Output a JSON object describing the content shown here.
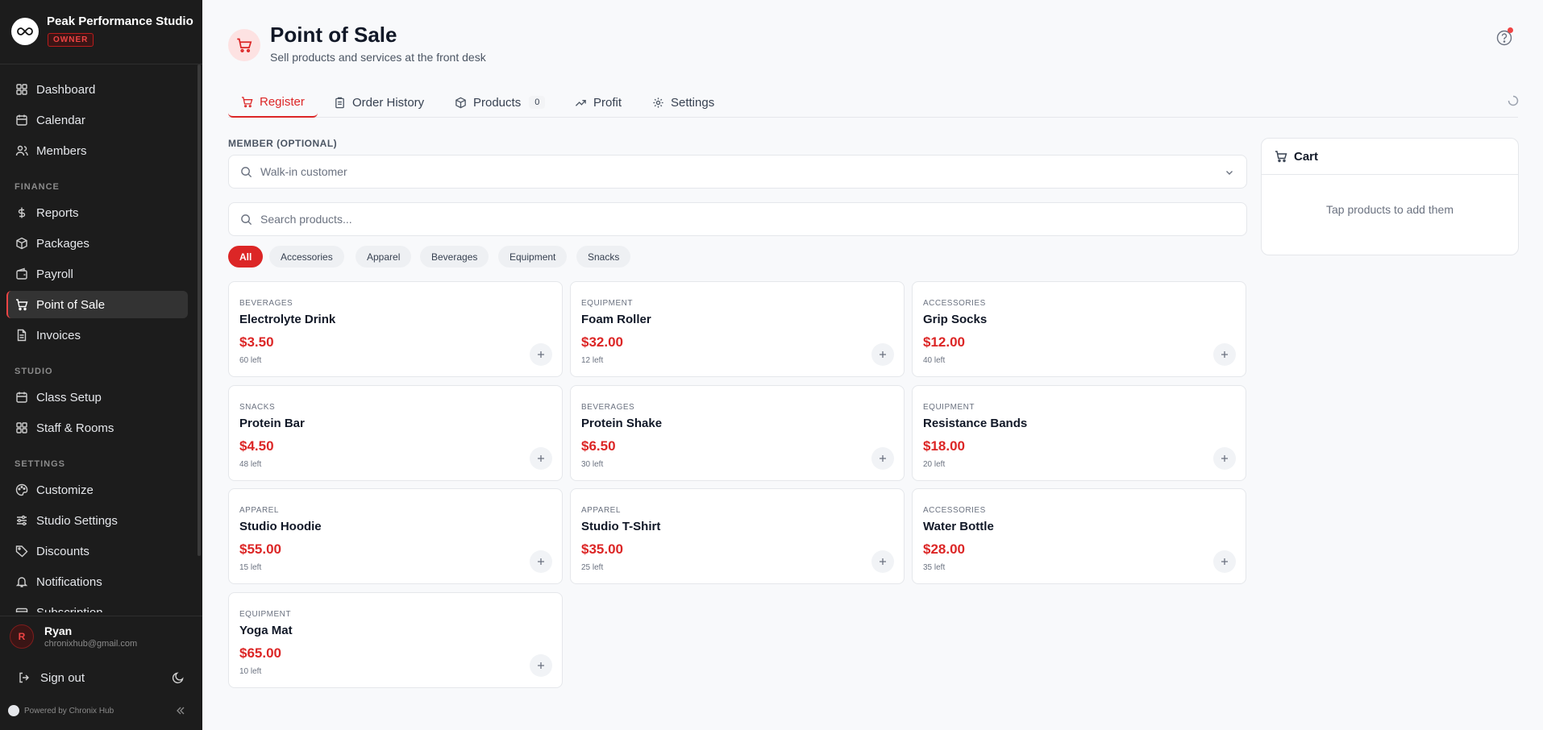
{
  "brand": {
    "name": "Peak Performance Studio",
    "role": "OWNER"
  },
  "nav": {
    "items": [
      {
        "label": "Dashboard"
      },
      {
        "label": "Calendar"
      },
      {
        "label": "Members"
      },
      {
        "label": "Reports"
      },
      {
        "label": "Packages"
      },
      {
        "label": "Payroll"
      },
      {
        "label": "Point of Sale"
      },
      {
        "label": "Invoices"
      },
      {
        "label": "Class Setup"
      },
      {
        "label": "Staff & Rooms"
      },
      {
        "label": "Customize"
      },
      {
        "label": "Studio Settings"
      },
      {
        "label": "Discounts"
      },
      {
        "label": "Notifications"
      },
      {
        "label": "Subscription"
      }
    ],
    "sections": {
      "finance": "FINANCE",
      "studio": "STUDIO",
      "settings": "SETTINGS"
    }
  },
  "user": {
    "initial": "R",
    "name": "Ryan",
    "email": "chronixhub@gmail.com",
    "signout": "Sign out"
  },
  "footer": {
    "powered": "Powered by Chronix Hub"
  },
  "page": {
    "title": "Point of Sale",
    "subtitle": "Sell products and services at the front desk"
  },
  "tabs": [
    {
      "label": "Register"
    },
    {
      "label": "Order History"
    },
    {
      "label": "Products",
      "count": "0"
    },
    {
      "label": "Profit"
    },
    {
      "label": "Settings"
    }
  ],
  "member": {
    "label": "MEMBER (OPTIONAL)",
    "placeholder": "Walk-in customer"
  },
  "search": {
    "placeholder": "Search products..."
  },
  "filters": [
    "All",
    "Accessories",
    "Apparel",
    "Beverages",
    "Equipment",
    "Snacks"
  ],
  "products": [
    {
      "category": "BEVERAGES",
      "name": "Electrolyte Drink",
      "price": "$3.50",
      "stock": "60 left"
    },
    {
      "category": "EQUIPMENT",
      "name": "Foam Roller",
      "price": "$32.00",
      "stock": "12 left"
    },
    {
      "category": "ACCESSORIES",
      "name": "Grip Socks",
      "price": "$12.00",
      "stock": "40 left"
    },
    {
      "category": "SNACKS",
      "name": "Protein Bar",
      "price": "$4.50",
      "stock": "48 left"
    },
    {
      "category": "BEVERAGES",
      "name": "Protein Shake",
      "price": "$6.50",
      "stock": "30 left"
    },
    {
      "category": "EQUIPMENT",
      "name": "Resistance Bands",
      "price": "$18.00",
      "stock": "20 left"
    },
    {
      "category": "APPAREL",
      "name": "Studio Hoodie",
      "price": "$55.00",
      "stock": "15 left"
    },
    {
      "category": "APPAREL",
      "name": "Studio T-Shirt",
      "price": "$35.00",
      "stock": "25 left"
    },
    {
      "category": "ACCESSORIES",
      "name": "Water Bottle",
      "price": "$28.00",
      "stock": "35 left"
    },
    {
      "category": "EQUIPMENT",
      "name": "Yoga Mat",
      "price": "$65.00",
      "stock": "10 left"
    }
  ],
  "cart": {
    "title": "Cart",
    "empty": "Tap products to add them"
  },
  "colors": {
    "accent": "#dc2626",
    "sidebar": "#1c1c1c"
  }
}
